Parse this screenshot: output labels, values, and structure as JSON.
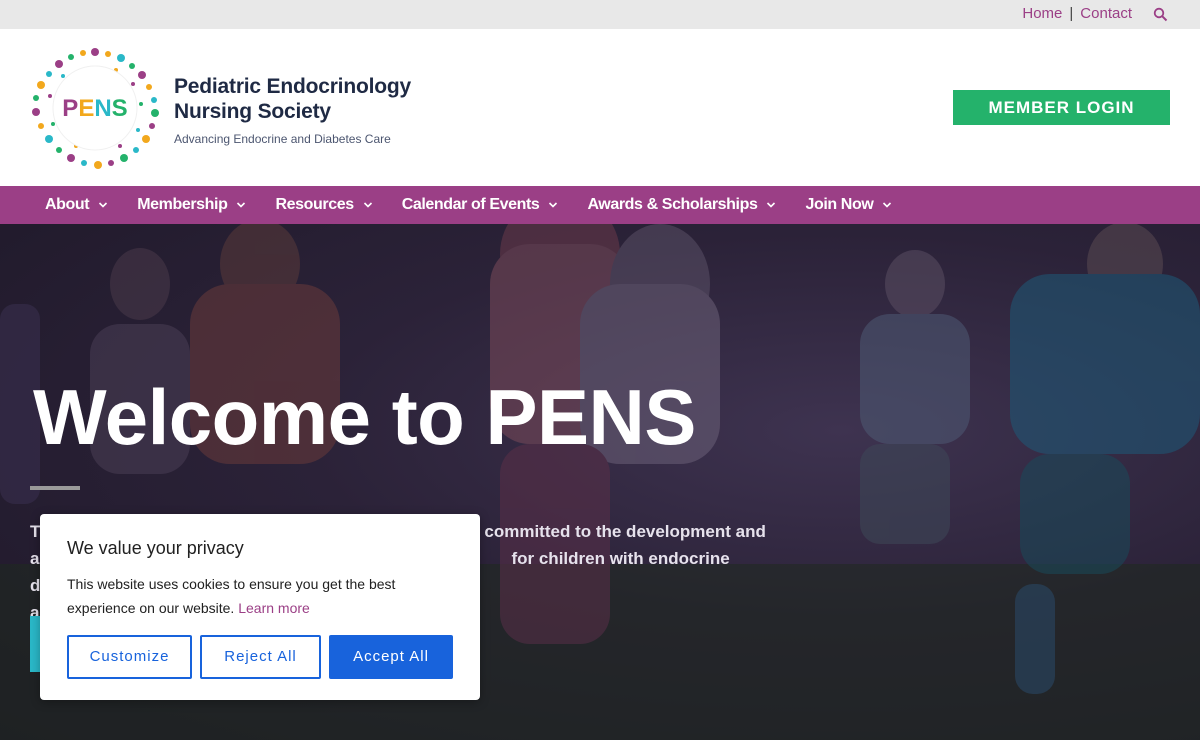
{
  "utility": {
    "home": "Home",
    "separator": "|",
    "contact": "Contact",
    "search_icon": "search-icon"
  },
  "header": {
    "logo_text": "PENS",
    "org_line1": "Pediatric Endocrinology",
    "org_line2": "Nursing Society",
    "tagline": "Advancing Endocrine and Diabetes Care",
    "member_login": "MEMBER LOGIN"
  },
  "nav": {
    "items": [
      {
        "label": "About"
      },
      {
        "label": "Membership"
      },
      {
        "label": "Resources"
      },
      {
        "label": "Calendar of Events"
      },
      {
        "label": "Awards & Scholarships"
      },
      {
        "label": "Join Now"
      }
    ]
  },
  "hero": {
    "title": "Welcome to PENS",
    "text_line1_visible": "committed to the development and",
    "text_line2_visible": "for children with endocrine disorders",
    "text_line1_start": "T",
    "text_line2_start": "a",
    "text_line3_start": "a"
  },
  "cookie": {
    "title": "We value your privacy",
    "body": "This website uses cookies to ensure you get the best experience on our website.",
    "learn_more": "Learn more",
    "customize": "Customize",
    "reject": "Reject All",
    "accept": "Accept All"
  },
  "colors": {
    "brand_purple": "#9b3f86",
    "member_green": "#24b26b",
    "cookie_blue": "#1863dc",
    "hero_teal_button": "#2ab8c8"
  }
}
